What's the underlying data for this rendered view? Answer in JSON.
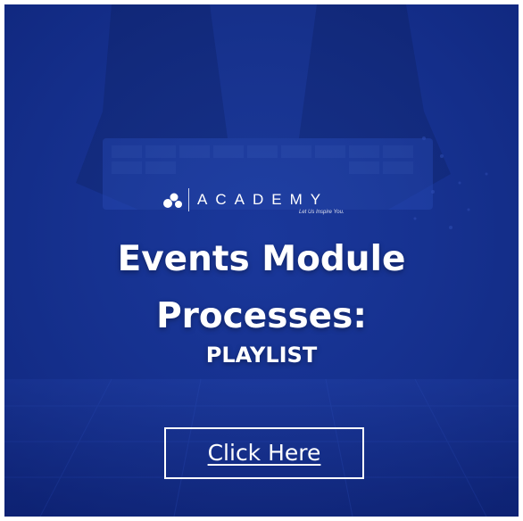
{
  "brand": {
    "name": "ACADEMY",
    "tagline": "Let Us Inspire You."
  },
  "headline": {
    "line1": "Events Module",
    "line2": "Processes:",
    "line3": "PLAYLIST"
  },
  "cta": {
    "label": "Click Here"
  },
  "colors": {
    "overlay": "#14308f",
    "text": "#ffffff"
  },
  "icons": {
    "logo": "academy-logo-icon"
  }
}
